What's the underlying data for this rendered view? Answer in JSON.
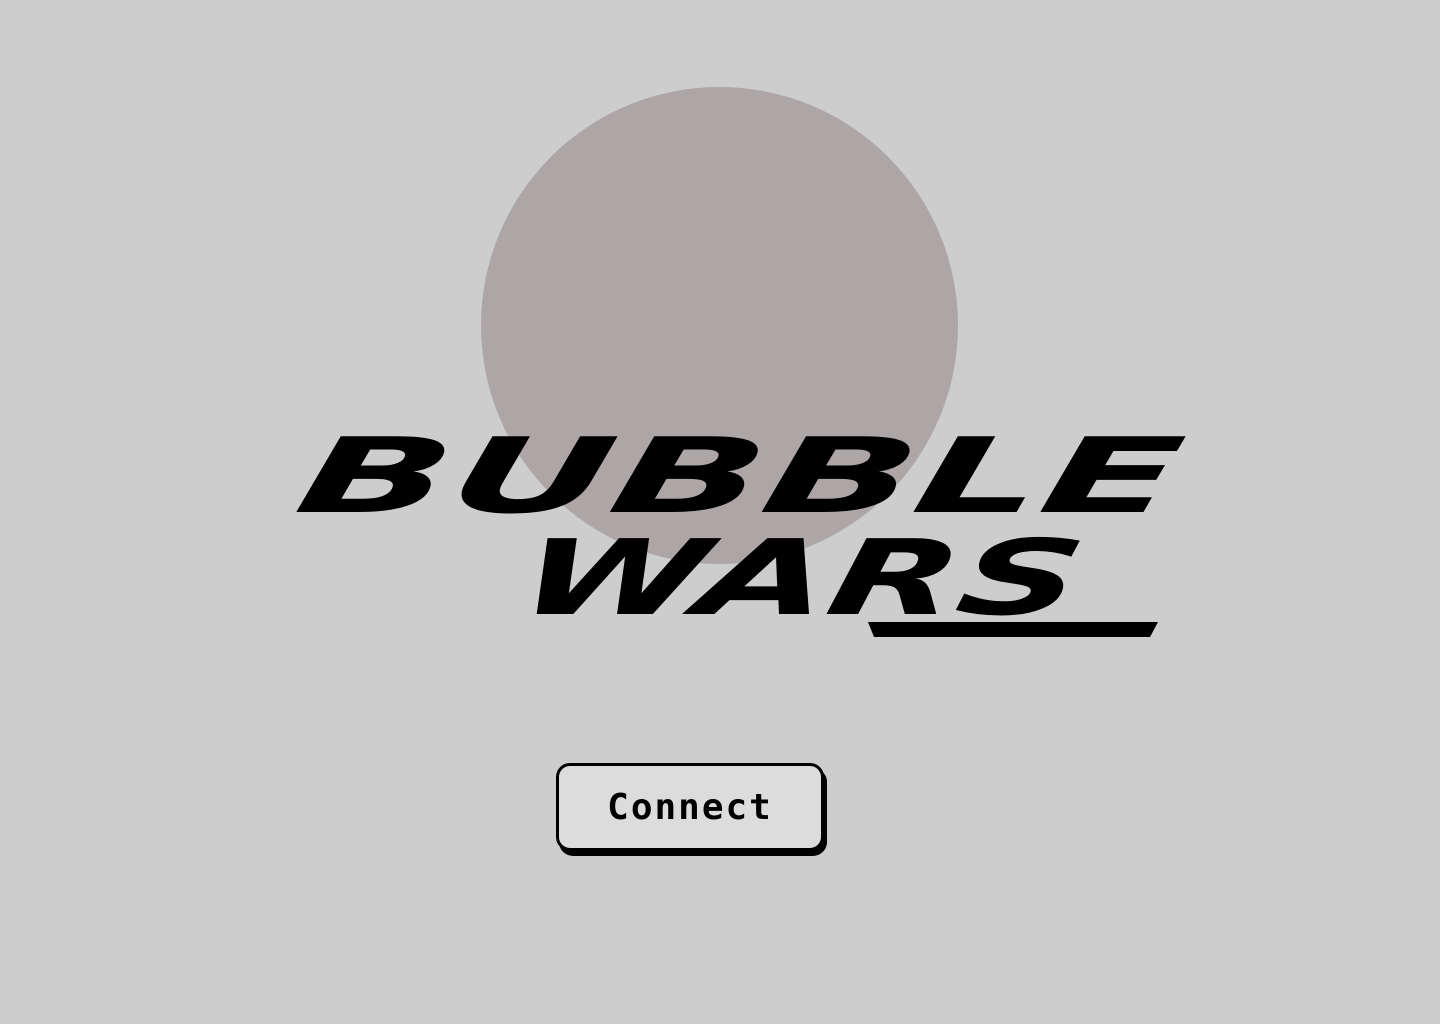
{
  "title": {
    "line1": "BUBBLE",
    "line2": "WARS"
  },
  "connect_button": {
    "label": "Connect"
  },
  "colors": {
    "background": "#cdcdcd",
    "sun": "#ada6a7",
    "ink": "#000000",
    "button_face": "#dcdcdc"
  }
}
